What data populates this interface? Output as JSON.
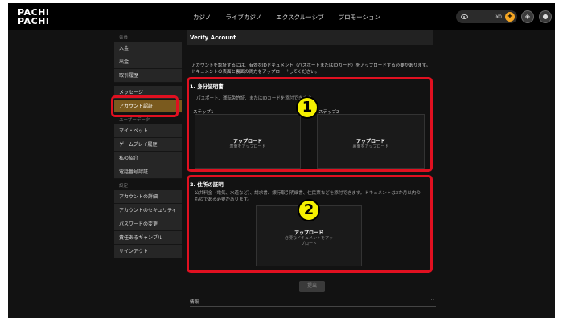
{
  "logo": {
    "line1": "PACHI",
    "line2": "PACHI"
  },
  "nav": [
    "カジノ",
    "ライブカジノ",
    "エクスクルーシブ",
    "プロモーション"
  ],
  "wallet": {
    "balance": "¥0",
    "plus": "+"
  },
  "sidebar": {
    "section1": "会員",
    "items1": [
      "入金",
      "出金",
      "取引履歴"
    ],
    "items2": [
      "メッセージ",
      "アカウント認証"
    ],
    "section3": "ユーザーデータ",
    "items3": [
      "マイ・ベット",
      "ゲームプレイ履歴",
      "私の紹介",
      "電話番号認証"
    ],
    "section4": "設定",
    "items4": [
      "アカウントの詳細",
      "アカウントのセキュリティ",
      "パスワードの変更",
      "責任あるギャンブル",
      "サインアウト"
    ]
  },
  "main": {
    "title": "Verify Account",
    "intro1": "アカウントを認証するには、有効なIDドキュメント（パスポートまたはIDカード）をアップロードする必要があります。",
    "intro2": "ドキュメントの表面と裏面の両方をアップロードしてください。",
    "id_section": {
      "title": "1. 身分証明書",
      "desc": "パスポート、運転免許証、またはIDカードを添付できます。",
      "step1": "ステップ1",
      "step2": "ステップ2",
      "box1_title": "アップロード",
      "box1_sub": "表面をアップロード",
      "box2_title": "アップロード",
      "box2_sub": "裏面をアップロード"
    },
    "address_section": {
      "title": "2. 住所の証明",
      "desc1": "公共料金（電気、水道など）、請求書、銀行取引明細書、住民票などを添付できます。ドキュメントは3か月以内の",
      "desc2": "ものである必要があります。",
      "box_title": "アップロード",
      "box_sub1": "必要なドキュメントをアッ",
      "box_sub2": "プロード"
    },
    "submit_label": "提出",
    "info_label": "情報",
    "info_arrow": "^"
  },
  "annotations": {
    "badge1": "1",
    "badge2": "2"
  }
}
